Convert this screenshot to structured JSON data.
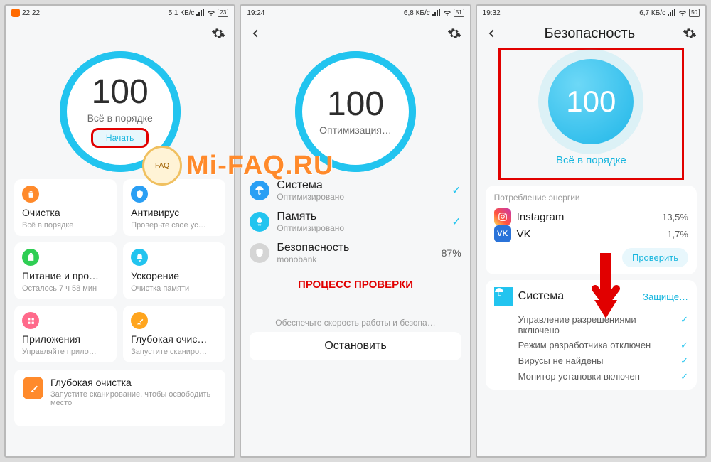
{
  "watermark_text": "Mi-FAQ.RU",
  "screen1": {
    "status": {
      "time": "22:22",
      "net": "5,1 КБ/с",
      "batt": "23"
    },
    "score": {
      "value": "100",
      "subtitle": "Всё в порядке",
      "button": "Начать"
    },
    "tiles": [
      {
        "title": "Очистка",
        "sub": "Всё в порядке",
        "icon": "trash-icon",
        "color": "bg-orange"
      },
      {
        "title": "Антивирус",
        "sub": "Проверьте свое ус…",
        "icon": "shield-icon",
        "color": "bg-blue"
      },
      {
        "title": "Питание и про…",
        "sub": "Осталось 7 ч 58 мин",
        "icon": "battery-icon",
        "color": "bg-green"
      },
      {
        "title": "Ускорение",
        "sub": "Очистка памяти",
        "icon": "bell-icon",
        "color": "bg-cyan"
      },
      {
        "title": "Приложения",
        "sub": "Управляйте прило…",
        "icon": "apps-icon",
        "color": "bg-pink"
      },
      {
        "title": "Глубокая очис…",
        "sub": "Запустите сканиро…",
        "icon": "broom-icon",
        "color": "bg-yellow"
      }
    ],
    "promo": {
      "title": "Глубокая очистка",
      "sub": "Запустите сканирование, чтобы освободить место"
    }
  },
  "screen2": {
    "status": {
      "time": "19:24",
      "net": "6,8 КБ/с",
      "batt": "51"
    },
    "score": {
      "value": "100",
      "subtitle": "Оптимизация…"
    },
    "items": [
      {
        "title": "Система",
        "sub": "Оптимизировано",
        "icon": "umbrella-icon",
        "circ": "blue",
        "tick": true
      },
      {
        "title": "Память",
        "sub": "Оптимизировано",
        "icon": "rocket-icon",
        "circ": "cyan",
        "tick": true
      },
      {
        "title": "Безопасность",
        "sub": "monobank",
        "icon": "shield-icon",
        "circ": "grey",
        "pct": "87%"
      }
    ],
    "caption": "ПРОЦЕСС ПРОВЕРКИ",
    "foot": "Обеспечьте скорость работы и безопа…",
    "stop": "Остановить"
  },
  "screen3": {
    "status": {
      "time": "19:32",
      "net": "6,7 КБ/с",
      "batt": "50"
    },
    "title": "Безопасность",
    "score": {
      "value": "100",
      "subtitle": "Всё в порядке"
    },
    "energy": {
      "head": "Потребление энергии",
      "rows": [
        {
          "name": "Instagram",
          "val": "13,5%",
          "icon": "instagram-icon"
        },
        {
          "name": "VK",
          "val": "1,7%",
          "icon": "vk-icon"
        }
      ],
      "button": "Проверить"
    },
    "system": {
      "title": "Система",
      "status": "Защище…",
      "bullets": [
        "Управление разрешениями включено",
        "Режим разработчика отключен",
        "Вирусы не найдены",
        "Монитор установки включен"
      ]
    }
  }
}
